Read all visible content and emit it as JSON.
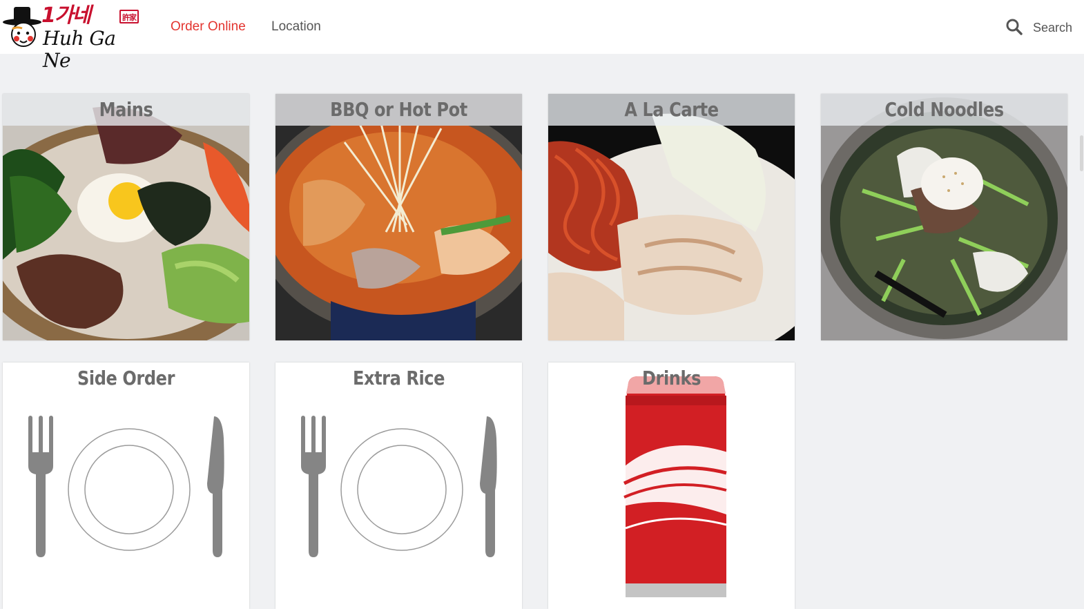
{
  "header": {
    "logo": {
      "korean_text": "1가네",
      "english_text": "Huh Ga Ne",
      "hanja_text": "許家"
    },
    "nav": [
      {
        "label": "Order Online",
        "active": true
      },
      {
        "label": "Location",
        "active": false
      }
    ],
    "search": {
      "label": "Search",
      "icon": "search-icon"
    }
  },
  "colors": {
    "accent": "#e3342f",
    "brand_red": "#c8102e",
    "nav_text": "#555555",
    "page_bg": "#f0f1f3",
    "title_text": "#6b6b6b"
  },
  "categories": [
    {
      "title": "Mains",
      "image": "bibimbap bowl with fried egg"
    },
    {
      "title": "BBQ or Hot Pot",
      "image": "spicy hot pot with enoki mushrooms"
    },
    {
      "title": "A La Carte",
      "image": "boiled pork slices with spicy radish"
    },
    {
      "title": "Cold Noodles",
      "image": "naengmyeon cold noodles with egg"
    },
    {
      "title": "Side Order",
      "image": "plate with fork and knife"
    },
    {
      "title": "Extra Rice",
      "image": "plate with fork and knife"
    },
    {
      "title": "Drinks",
      "image": "red cola can"
    }
  ]
}
